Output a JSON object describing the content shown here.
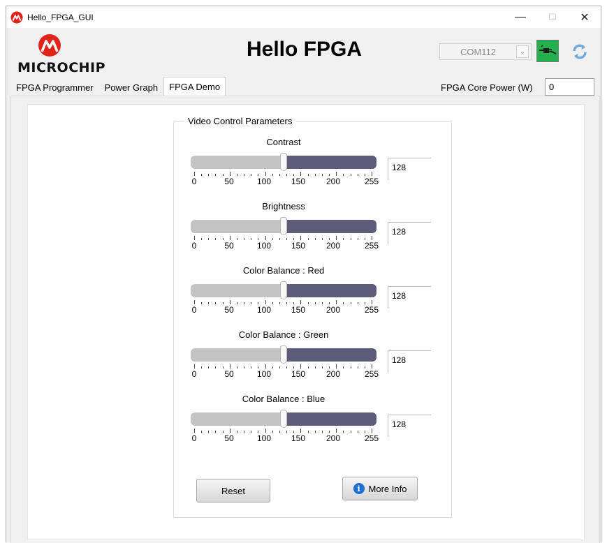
{
  "window": {
    "title": "Hello_FPGA_GUI",
    "minimize_glyph": "—",
    "maximize_glyph": "☐",
    "close_glyph": "✕"
  },
  "header": {
    "logo_text": "MICROCHIP",
    "app_title": "Hello FPGA",
    "com_port": "COM112",
    "power_label": "FPGA Core Power (W)",
    "power_value": "0"
  },
  "tabs": [
    {
      "label": "FPGA Programmer",
      "active": false
    },
    {
      "label": "Power Graph",
      "active": false
    },
    {
      "label": "FPGA Demo",
      "active": true
    }
  ],
  "demo": {
    "group_title": "Video Control Parameters",
    "scale": {
      "min": 0,
      "max": 255,
      "tick_labels": [
        "0",
        "50",
        "100",
        "150",
        "200",
        "255"
      ]
    },
    "sliders": [
      {
        "label": "Contrast",
        "value": "128"
      },
      {
        "label": "Brightness",
        "value": "128"
      },
      {
        "label": "Color Balance : Red",
        "value": "128"
      },
      {
        "label": "Color Balance : Green",
        "value": "128"
      },
      {
        "label": "Color Balance : Blue",
        "value": "128"
      }
    ],
    "reset_label": "Reset",
    "info_label": "More Info"
  },
  "colors": {
    "track_filled": "#c4c4c4",
    "track_empty": "#5c5c7a",
    "connect_green": "#22b14c",
    "microchip_red": "#e2231a"
  },
  "icons": {
    "app": "microchip-logo-icon",
    "connect": "usb-plug-icon",
    "refresh": "refresh-icon",
    "info": "info-icon"
  }
}
